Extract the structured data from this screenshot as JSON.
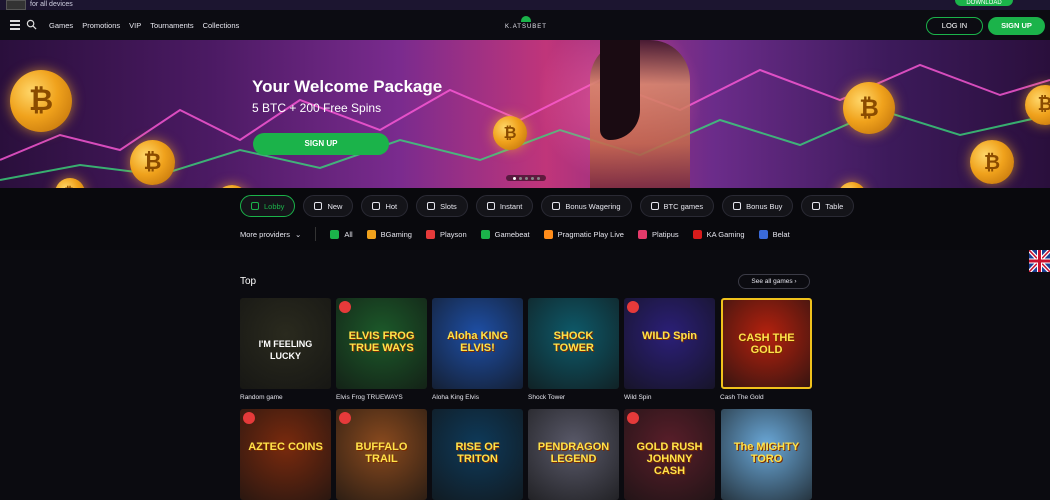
{
  "promo": {
    "text": "for all devices",
    "download": "DOWNLOAD"
  },
  "header": {
    "nav": [
      "Games",
      "Promotions",
      "VIP",
      "Tournaments",
      "Collections"
    ],
    "logo": "K.ATSUBET",
    "login": "LOG IN",
    "signup": "SIGN UP"
  },
  "hero": {
    "title": "Your Welcome Package",
    "subtitle": "5 BTC + 200 Free Spins",
    "button": "SIGN UP",
    "coin_symbol": "₿"
  },
  "categories": [
    "Lobby",
    "New",
    "Hot",
    "Slots",
    "Instant",
    "Bonus Wagering",
    "BTC games",
    "Bonus Buy",
    "Table"
  ],
  "providers": {
    "more": "More providers",
    "items": [
      "All",
      "BGaming",
      "Playson",
      "Gamebeat",
      "Pragmatic Play Live",
      "Platipus",
      "KA Gaming",
      "Belat"
    ]
  },
  "top": {
    "title": "Top",
    "see_all": "See all games",
    "row1": [
      {
        "art": "I'M FEELING LUCKY",
        "label": "Random game",
        "bg": "#2a2a1e",
        "hot": false
      },
      {
        "art": "ELVIS FROG TRUE WAYS",
        "label": "Elvis Frog TRUEWAYS",
        "bg": "#1c5a2a",
        "hot": true
      },
      {
        "art": "Aloha KING ELVIS!",
        "label": "Aloha King Elvis",
        "bg": "#1e4fa6",
        "hot": false
      },
      {
        "art": "SHOCK TOWER",
        "label": "Shock Tower",
        "bg": "#0e5a6a",
        "hot": false
      },
      {
        "art": "WILD Spin",
        "label": "Wild Spin",
        "bg": "#2b1f78",
        "hot": true
      },
      {
        "art": "CASH THE GOLD",
        "label": "Cash The Gold",
        "bg": "#b5210e",
        "hot": false
      }
    ],
    "row2": [
      {
        "art": "AZTEC COINS",
        "bg": "#7a2a0e",
        "hot": true
      },
      {
        "art": "BUFFALO TRAIL",
        "bg": "#8a4a1e",
        "hot": true
      },
      {
        "art": "RISE OF TRITON",
        "bg": "#0e3a5a",
        "hot": false
      },
      {
        "art": "PENDRAGON LEGEND",
        "bg": "#5a5a6a",
        "hot": false
      },
      {
        "art": "GOLD RUSH JOHNNY CASH",
        "bg": "#5a1e2a",
        "hot": true
      },
      {
        "art": "The MIGHTY TORO",
        "bg": "#6aa8d8",
        "hot": false
      }
    ]
  }
}
